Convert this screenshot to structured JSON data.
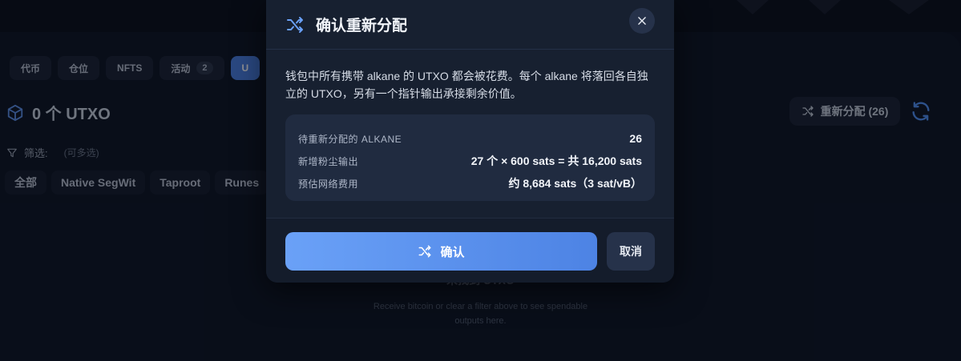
{
  "tabs": [
    {
      "label": "代币"
    },
    {
      "label": "仓位"
    },
    {
      "label": "NFTS"
    },
    {
      "label": "活动",
      "badge": "2"
    },
    {
      "label": "U"
    }
  ],
  "utxo_header": {
    "title": "0 个 UTXO"
  },
  "filter": {
    "label": "筛选:",
    "hint": "(可多选)"
  },
  "chips": [
    "全部",
    "Native SegWit",
    "Taproot",
    "Runes"
  ],
  "redistribute_button": {
    "label": "重新分配 (26)"
  },
  "empty_state": {
    "title": "未找到 UTXO",
    "line1": "Receive bitcoin or clear a filter above to see spendable",
    "line2": "outputs here."
  },
  "modal": {
    "title": "确认重新分配",
    "description": "钱包中所有携带 alkane 的 UTXO 都会被花费。每个 alkane 将落回各自独立的 UTXO，另有一个指针输出承接剩余价值。",
    "rows": [
      {
        "label": "待重新分配的 ALKANE",
        "value": "26"
      },
      {
        "label": "新增粉尘输出",
        "value": "27 个 × 600 sats = 共 16,200 sats"
      },
      {
        "label": "预估网络费用",
        "value": "约 8,684 sats（3 sat/vB）"
      }
    ],
    "confirm_label": "确认",
    "cancel_label": "取消"
  },
  "colors": {
    "accent": "#4d83e4",
    "background": "#0b1120",
    "modal": "#172030"
  }
}
